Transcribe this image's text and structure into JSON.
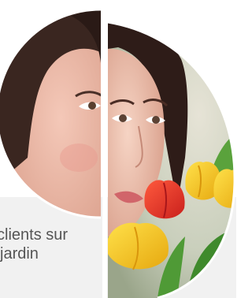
{
  "caption": {
    "line1": "clients sur",
    "line2": "jardin"
  },
  "colors": {
    "background": "#ffffff",
    "caption_panel": "#f1f1f1",
    "caption_text": "#555555",
    "tulip_yellow": "#f3c21b",
    "tulip_red": "#e8312b",
    "leaf_green": "#3f8a2c"
  },
  "image": {
    "left_half": "woman-face-cutout",
    "right_half": "woman-smelling-tulips-cutout"
  }
}
